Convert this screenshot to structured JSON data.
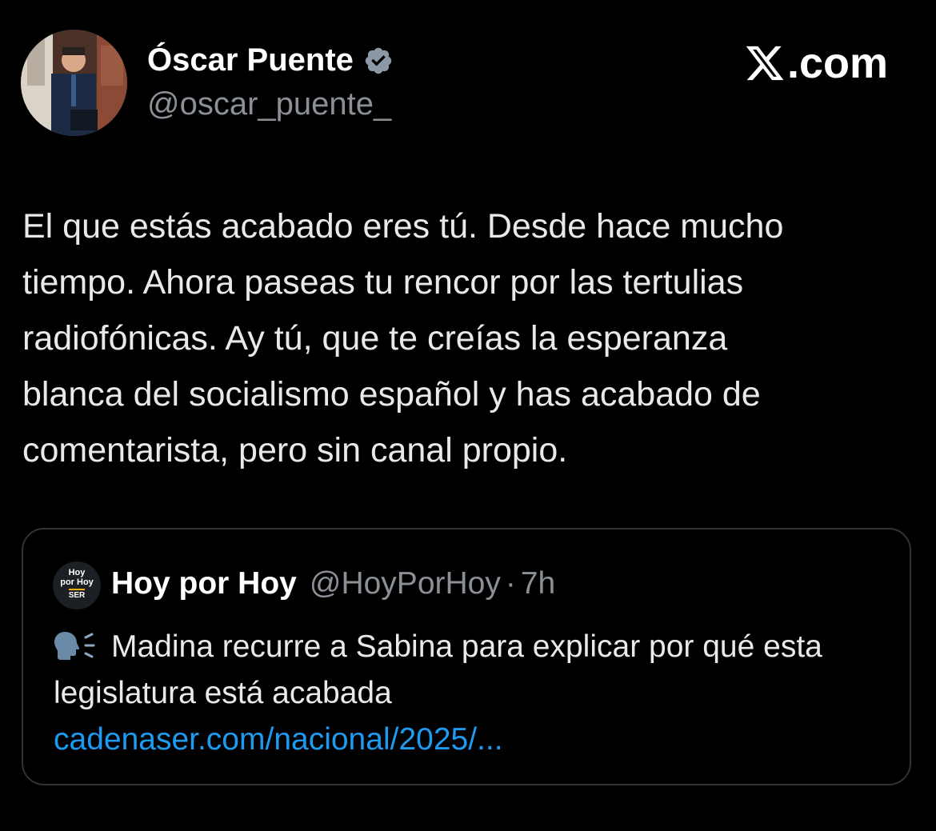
{
  "author": {
    "display_name": "Óscar Puente",
    "handle": "@oscar_puente_",
    "verified_icon": "verified-badge-icon"
  },
  "brand": {
    "label": ".com",
    "icon": "x-logo-icon"
  },
  "tweet": {
    "text": "El que estás acabado eres tú. Desde hace mucho\ntiempo. Ahora paseas tu rencor por las tertulias\nradiofónicas. Ay tú, que te creías la esperanza\nblanca del socialismo español y has acabado de\ncomentarista, pero sin canal propio."
  },
  "quote": {
    "avatar_text": {
      "line1": "Hoy",
      "line2": "por Hoy",
      "line3": "SER"
    },
    "name": "Hoy por Hoy",
    "handle": "@HoyPorHoy",
    "separator": "·",
    "time": "7h",
    "text": "Madina recurre a Sabina para explicar por qué esta legislatura está acabada",
    "link": "cadenaser.com/nacional/2025/...",
    "emoji_icon": "speaking-head-icon"
  },
  "colors": {
    "background": "#000000",
    "text": "#e7e9ea",
    "secondary": "#8b9096",
    "link": "#1d9bf0",
    "verified": "#8b98a5",
    "border": "#2f3336"
  }
}
